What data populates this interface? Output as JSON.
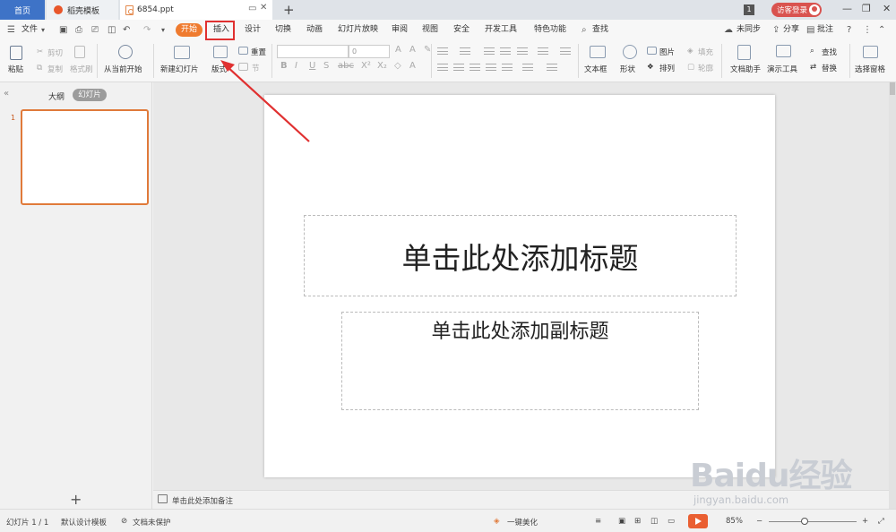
{
  "tabs": {
    "home": "首页",
    "template": "稻壳模板",
    "document": "6854.ppt",
    "new_tab": "+"
  },
  "header_right": {
    "badge": "1",
    "login": "访客登录"
  },
  "menu": {
    "file": "文件",
    "start": "开始",
    "items": [
      "插入",
      "设计",
      "切换",
      "动画",
      "幻灯片放映",
      "审阅",
      "视图",
      "安全",
      "开发工具",
      "特色功能"
    ],
    "search": "查找",
    "sync": "未同步",
    "share": "分享",
    "comment": "批注"
  },
  "ribbon": {
    "paste": "粘贴",
    "cut": "剪切",
    "copy": "复制",
    "format_painter": "格式刷",
    "from_current": "从当前开始",
    "new_slide": "新建幻灯片",
    "layout": "版式",
    "section": "节",
    "reset": "重置",
    "font_size": "0",
    "textbox": "文本框",
    "shape": "形状",
    "picture": "图片",
    "fill": "填充",
    "arrange": "排列",
    "outline": "轮廓",
    "doc_assistant": "文档助手",
    "present_tools": "演示工具",
    "find": "查找",
    "replace": "替换",
    "select_pane": "选择窗格"
  },
  "left_panel": {
    "outline_tab": "大纲",
    "slides_tab": "幻灯片",
    "slide_number": "1"
  },
  "slide": {
    "title_placeholder": "单击此处添加标题",
    "subtitle_placeholder": "单击此处添加副标题"
  },
  "notes": {
    "placeholder": "单击此处添加备注"
  },
  "status": {
    "slide_count": "幻灯片 1 / 1",
    "template": "默认设计模板",
    "protection": "文档未保护",
    "beautify": "一键美化",
    "zoom": "85%"
  },
  "watermark": {
    "brand": "Baidu经验",
    "url": "jingyan.baidu.com"
  },
  "colors": {
    "accent_orange": "#ef7b2f",
    "home_tab_blue": "#3e73c7",
    "annotation_red": "#e03030"
  }
}
